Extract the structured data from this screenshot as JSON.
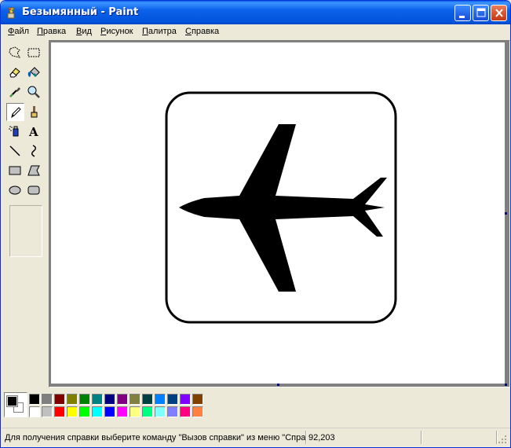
{
  "window": {
    "title": "Безымянный - Paint",
    "accent": "#0255dd"
  },
  "menu": {
    "items": [
      {
        "label": "Файл",
        "accel": "Ф",
        "rest": "айл"
      },
      {
        "label": "Правка",
        "accel": "П",
        "rest": "равка"
      },
      {
        "label": "Вид",
        "accel": "В",
        "rest": "ид"
      },
      {
        "label": "Рисунок",
        "accel": "Р",
        "rest": "исунок"
      },
      {
        "label": "Палитра",
        "accel": "П",
        "rest": "алитра"
      },
      {
        "label": "Справка",
        "accel": "С",
        "rest": "правка"
      }
    ]
  },
  "tools": [
    {
      "name": "free-form-select-icon"
    },
    {
      "name": "rect-select-icon"
    },
    {
      "name": "eraser-icon"
    },
    {
      "name": "fill-bucket-icon"
    },
    {
      "name": "color-picker-icon"
    },
    {
      "name": "magnifier-icon"
    },
    {
      "name": "pencil-icon",
      "active": true
    },
    {
      "name": "brush-icon"
    },
    {
      "name": "airbrush-icon"
    },
    {
      "name": "text-icon",
      "glyph": "A"
    },
    {
      "name": "line-icon"
    },
    {
      "name": "curve-icon"
    },
    {
      "name": "rectangle-icon"
    },
    {
      "name": "polygon-icon"
    },
    {
      "name": "ellipse-icon"
    },
    {
      "name": "rounded-rect-icon"
    }
  ],
  "palette": {
    "foreground": "#000000",
    "background": "#ffffff",
    "row1": [
      "#000000",
      "#808080",
      "#800000",
      "#808000",
      "#008000",
      "#008080",
      "#000080",
      "#800080",
      "#808040",
      "#004040",
      "#0080ff",
      "#004080",
      "#8000ff",
      "#804000"
    ],
    "row2": [
      "#ffffff",
      "#c0c0c0",
      "#ff0000",
      "#ffff00",
      "#00ff00",
      "#00ffff",
      "#0000ff",
      "#ff00ff",
      "#ffff80",
      "#00ff80",
      "#80ffff",
      "#8080ff",
      "#ff0080",
      "#ff8040"
    ]
  },
  "status": {
    "help_text": "Для получения справки выберите команду \"Вызов справки\" из меню \"Справка\".",
    "coords": "92,203"
  }
}
